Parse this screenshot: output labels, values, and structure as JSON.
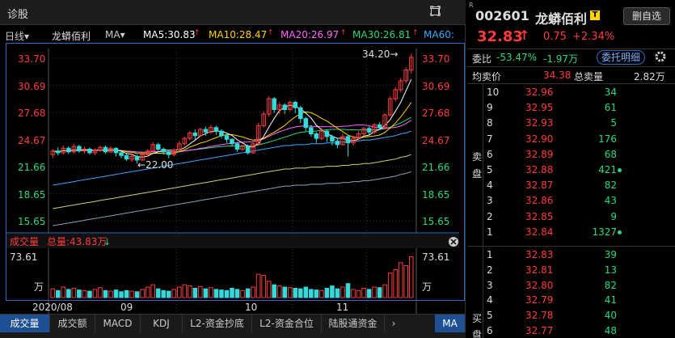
{
  "top_tab": {
    "title": "诊股"
  },
  "infobar": {
    "period": "日线▾",
    "stock_name": "龙蟒佰利",
    "ma_select": "MA▾",
    "ma5": "MA5:30.83",
    "ma10": "MA10:28.47",
    "ma20": "MA20:26.97",
    "ma30": "MA30:26.81",
    "ma60": "MA60:",
    "colors": {
      "ma5": "#ffffff",
      "ma10": "#ffd400",
      "ma20": "#ff66ff",
      "ma30": "#2bd97c",
      "ma60": "#36a8ff"
    }
  },
  "price_axis": {
    "labels": [
      "33.70",
      "30.69",
      "27.68",
      "24.67",
      "21.66",
      "18.65",
      "15.65"
    ],
    "values": [
      33.7,
      30.69,
      27.68,
      24.67,
      21.66,
      18.65,
      15.65
    ]
  },
  "annotations": {
    "high": "34.20→",
    "low": "←22.00"
  },
  "volume": {
    "title": "成交量",
    "total": "总量:43.83万",
    "axis_top": "73.61",
    "axis_unit": "万",
    "max": 73.61
  },
  "date_axis": {
    "labels": [
      "2020/08",
      "09",
      "10",
      "11"
    ]
  },
  "bottom_tabs": [
    "成交量",
    "成交额",
    "MACD",
    "KDJ",
    "L2-资金抄底",
    "L2-资金合位",
    "陆股通资金"
  ],
  "bottom_more": "MA",
  "quote": {
    "code": "002601",
    "name": "龙蟒佰利",
    "badge": "T",
    "add_button": "删自选",
    "price": "32.83",
    "change": "0.75",
    "change_pct": "+2.34%",
    "weibi_label": "委比",
    "weibi_pct": "-53.47%",
    "weicha": "-1.97万",
    "detail_button": "委托明细",
    "avg_label": "均卖价",
    "avg_value": "34.38",
    "total_sell_label": "总卖量",
    "total_sell_value": "2.82万",
    "sell_label": [
      "卖",
      "盘"
    ],
    "buy_label": [
      "买",
      "盘"
    ],
    "sells": [
      {
        "level": "10",
        "price": "32.96",
        "vol": "34",
        "dot": false
      },
      {
        "level": "9",
        "price": "32.95",
        "vol": "61",
        "dot": false
      },
      {
        "level": "8",
        "price": "32.93",
        "vol": "5",
        "dot": false
      },
      {
        "level": "7",
        "price": "32.90",
        "vol": "176",
        "dot": false
      },
      {
        "level": "6",
        "price": "32.89",
        "vol": "68",
        "dot": false
      },
      {
        "level": "5",
        "price": "32.88",
        "vol": "421",
        "dot": true
      },
      {
        "level": "4",
        "price": "32.87",
        "vol": "82",
        "dot": false
      },
      {
        "level": "3",
        "price": "32.86",
        "vol": "43",
        "dot": false
      },
      {
        "level": "2",
        "price": "32.85",
        "vol": "9",
        "dot": false
      },
      {
        "level": "1",
        "price": "32.84",
        "vol": "1327",
        "dot": true
      }
    ],
    "buys": [
      {
        "level": "1",
        "price": "32.83",
        "vol": "39",
        "dot": false
      },
      {
        "level": "2",
        "price": "32.81",
        "vol": "13",
        "dot": false
      },
      {
        "level": "3",
        "price": "32.80",
        "vol": "82",
        "dot": false
      },
      {
        "level": "4",
        "price": "32.79",
        "vol": "41",
        "dot": false
      },
      {
        "level": "5",
        "price": "32.78",
        "vol": "40",
        "dot": false
      },
      {
        "level": "6",
        "price": "32.77",
        "vol": "48",
        "dot": false
      }
    ]
  },
  "chart_data": {
    "type": "candlestick",
    "y_range": [
      15.65,
      33.7
    ],
    "candles": [
      [
        23.0,
        23.4,
        22.6,
        23.6
      ],
      [
        23.4,
        23.2,
        22.9,
        23.8
      ],
      [
        23.2,
        23.7,
        23.0,
        24.0
      ],
      [
        23.7,
        23.3,
        23.1,
        23.9
      ],
      [
        23.3,
        23.9,
        23.1,
        24.2
      ],
      [
        23.9,
        23.4,
        23.2,
        24.1
      ],
      [
        23.4,
        23.6,
        23.1,
        23.9
      ],
      [
        23.6,
        23.2,
        23.0,
        23.8
      ],
      [
        23.2,
        23.5,
        22.9,
        23.7
      ],
      [
        23.5,
        23.8,
        23.3,
        24.0
      ],
      [
        23.8,
        23.3,
        23.1,
        24.0
      ],
      [
        23.3,
        23.7,
        23.2,
        23.9
      ],
      [
        23.7,
        23.2,
        22.8,
        23.8
      ],
      [
        23.2,
        22.9,
        22.6,
        23.4
      ],
      [
        22.9,
        22.5,
        22.3,
        23.1
      ],
      [
        22.5,
        22.8,
        22.2,
        23.0
      ],
      [
        22.8,
        22.4,
        22.0,
        23.0
      ],
      [
        22.4,
        23.0,
        22.3,
        23.2
      ],
      [
        23.0,
        23.4,
        22.8,
        23.6
      ],
      [
        23.4,
        24.1,
        23.2,
        24.4
      ],
      [
        24.1,
        23.6,
        23.3,
        24.3
      ],
      [
        23.6,
        23.3,
        23.0,
        23.8
      ],
      [
        23.3,
        23.0,
        22.6,
        23.5
      ],
      [
        23.0,
        23.5,
        22.8,
        23.7
      ],
      [
        23.5,
        24.2,
        23.4,
        24.5
      ],
      [
        24.2,
        24.8,
        24.0,
        25.0
      ],
      [
        24.8,
        25.4,
        24.6,
        25.6
      ],
      [
        25.4,
        25.1,
        24.7,
        25.8
      ],
      [
        25.1,
        25.8,
        25.0,
        26.0
      ],
      [
        25.8,
        25.5,
        25.1,
        26.1
      ],
      [
        25.5,
        26.0,
        25.3,
        26.3
      ],
      [
        26.0,
        25.6,
        25.2,
        26.2
      ],
      [
        25.6,
        25.1,
        24.8,
        25.8
      ],
      [
        25.1,
        24.7,
        24.3,
        25.3
      ],
      [
        24.7,
        24.2,
        23.9,
        24.8
      ],
      [
        24.2,
        23.6,
        23.3,
        24.4
      ],
      [
        23.6,
        23.9,
        23.4,
        24.1
      ],
      [
        23.9,
        23.2,
        23.0,
        24.1
      ],
      [
        23.2,
        24.2,
        23.1,
        24.4
      ],
      [
        24.2,
        26.2,
        24.0,
        26.5
      ],
      [
        26.2,
        27.5,
        26.0,
        27.8
      ],
      [
        27.5,
        29.2,
        27.2,
        29.5
      ],
      [
        29.2,
        28.0,
        27.6,
        29.4
      ],
      [
        28.0,
        28.5,
        27.5,
        28.8
      ],
      [
        28.5,
        28.0,
        27.5,
        28.7
      ],
      [
        28.0,
        28.8,
        27.8,
        29.0
      ],
      [
        28.8,
        28.2,
        27.6,
        29.0
      ],
      [
        28.2,
        27.0,
        26.5,
        28.4
      ],
      [
        27.0,
        26.0,
        25.6,
        27.2
      ],
      [
        26.0,
        25.3,
        25.0,
        26.3
      ],
      [
        25.3,
        24.8,
        24.3,
        25.5
      ],
      [
        24.8,
        25.6,
        24.6,
        26.0
      ],
      [
        25.6,
        25.0,
        24.4,
        25.8
      ],
      [
        25.0,
        24.5,
        24.0,
        25.2
      ],
      [
        24.5,
        24.1,
        23.7,
        24.8
      ],
      [
        24.1,
        25.0,
        24.0,
        25.3
      ],
      [
        25.0,
        24.3,
        22.8,
        25.2
      ],
      [
        24.3,
        24.8,
        24.0,
        25.1
      ],
      [
        24.8,
        25.3,
        24.6,
        25.6
      ],
      [
        25.3,
        25.9,
        25.1,
        26.1
      ],
      [
        25.9,
        25.5,
        25.2,
        26.1
      ],
      [
        25.5,
        26.3,
        25.3,
        26.5
      ],
      [
        26.3,
        26.0,
        25.7,
        26.6
      ],
      [
        26.0,
        27.4,
        25.9,
        27.6
      ],
      [
        27.4,
        29.2,
        27.2,
        29.5
      ],
      [
        29.2,
        30.2,
        28.9,
        30.5
      ],
      [
        30.2,
        31.2,
        29.9,
        31.5
      ],
      [
        31.2,
        32.4,
        30.9,
        32.7
      ],
      [
        32.4,
        33.8,
        32.0,
        34.2
      ]
    ],
    "volumes": [
      15,
      12,
      18,
      14,
      16,
      13,
      12,
      11,
      14,
      17,
      12,
      11,
      13,
      10,
      12,
      11,
      10,
      14,
      18,
      22,
      15,
      12,
      11,
      14,
      18,
      22,
      20,
      16,
      19,
      15,
      17,
      14,
      13,
      12,
      16,
      14,
      12,
      15,
      18,
      40,
      38,
      28,
      22,
      20,
      18,
      17,
      16,
      15,
      18,
      14,
      13,
      12,
      16,
      20,
      15,
      18,
      24,
      14,
      12,
      16,
      14,
      18,
      17,
      22,
      42,
      48,
      60,
      55,
      70
    ],
    "ma_lines": {
      "ma60": [
        19.6,
        19.7,
        19.8,
        19.9,
        20.0,
        20.1,
        20.2,
        20.3,
        20.4,
        20.5,
        20.6,
        20.7,
        20.8,
        20.9,
        21.0,
        21.1,
        21.2,
        21.3,
        21.4,
        21.5,
        21.6,
        21.7,
        21.8,
        21.9,
        22.0,
        22.1,
        22.2,
        22.3,
        22.4,
        22.5,
        22.6,
        22.7,
        22.8,
        22.9,
        23.0,
        23.1,
        23.2,
        23.3,
        23.4,
        23.5,
        23.6,
        23.7,
        23.8,
        23.9,
        24.0,
        24.0,
        24.1,
        24.1,
        24.1,
        24.2,
        24.2,
        24.2,
        24.3,
        24.3,
        24.3,
        24.4,
        24.4,
        24.5,
        24.5,
        24.6,
        24.6,
        24.7,
        24.8,
        24.9,
        25.0,
        25.1,
        25.3,
        25.4,
        25.6
      ]
    },
    "xlabel": "",
    "ylabel": ""
  }
}
